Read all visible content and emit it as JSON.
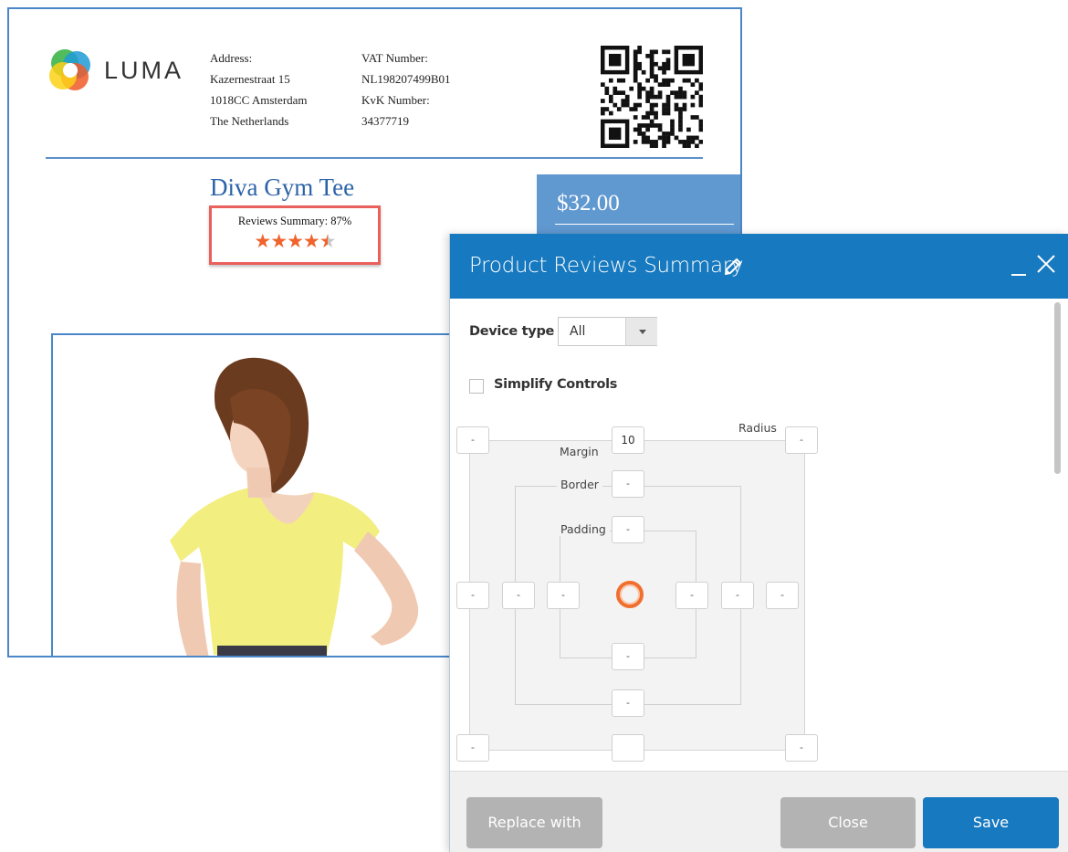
{
  "invoice": {
    "brand": "LUMA",
    "address": [
      "Address:",
      "Kazernestraat 15",
      "1018CC Amsterdam",
      "The Netherlands"
    ],
    "vat": [
      "VAT Number:",
      "NL198207499B01",
      "KvK Number:",
      "34377719"
    ],
    "product_title": "Diva Gym Tee",
    "reviews_summary_label": "Reviews Summary: 87%",
    "rating": 4.35,
    "rating_max": 5,
    "price": "$32.00"
  },
  "modal": {
    "title": "Product Reviews Summary",
    "device_type_label": "Device type",
    "device_type_value": "All",
    "simplify_label": "Simplify Controls",
    "simplify_checked": false,
    "spacing": {
      "radius_label": "Radius",
      "margin_label": "Margin",
      "border_label": "Border",
      "padding_label": "Padding",
      "radius_top_left": "-",
      "radius_top_right": "-",
      "radius_bottom_left": "-",
      "radius_bottom_right": "-",
      "margin_top": "10",
      "margin_left": "-",
      "margin_right": "-",
      "margin_bottom": "",
      "border_top": "-",
      "border_left": "-",
      "border_right": "-",
      "border_bottom": "-",
      "padding_top": "-",
      "padding_left": "-",
      "padding_right": "-",
      "padding_bottom": "-"
    },
    "buttons": {
      "replace": "Replace with",
      "close": "Close",
      "save": "Save"
    }
  },
  "colors": {
    "header_blue": "#1779bf",
    "invoice_blue": "#2c63a8",
    "price_bg": "#6098d0",
    "highlight_red": "#e9605c",
    "star_orange": "#f0632d",
    "button_gray": "#b3b3b3"
  }
}
